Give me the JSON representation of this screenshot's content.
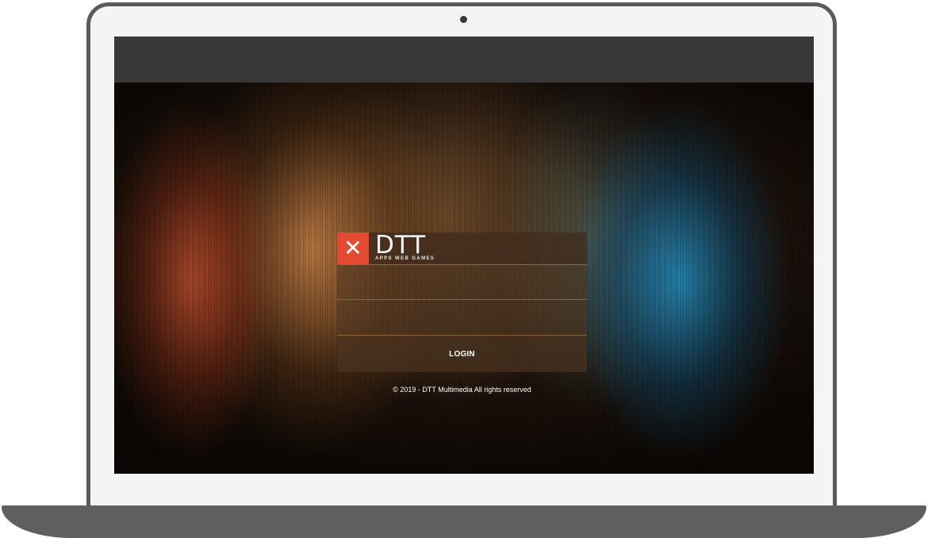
{
  "brand": {
    "logo_mark": "✕",
    "name": "DTT",
    "tagline": "APPS WEB GAMES",
    "accent_color": "#e34a33"
  },
  "login_form": {
    "username_value": "",
    "password_value": "",
    "submit_label": "LOGIN"
  },
  "footer": {
    "copyright": "© 2019 - DTT Multimedia All rights reserved"
  }
}
